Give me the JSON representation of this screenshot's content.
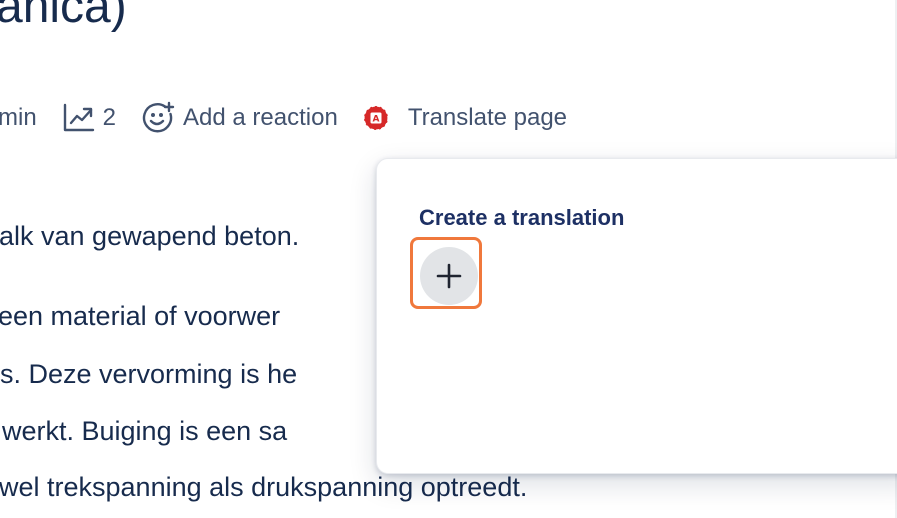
{
  "page": {
    "title": "anica)"
  },
  "meta": {
    "read_time": "min",
    "views_count": "2",
    "add_reaction_label": "Add a reaction",
    "translate_label": "Translate page"
  },
  "content": {
    "lines": [
      "alk van gewapend beton.",
      "een material of voorwer",
      "s. Deze vervorming is he",
      "werkt. Buiging is een sa",
      "wel trekspanning als drukspanning optreedt."
    ]
  },
  "popup": {
    "heading": "Create a translation",
    "add_button_label": "+"
  },
  "icons": {
    "views": "trending-chart-icon",
    "reaction": "add-reaction-icon",
    "translate": "translate-globe-icon",
    "add": "plus-icon"
  },
  "colors": {
    "highlight": "#f0783c",
    "translate_icon": "#d62828",
    "heading": "#1d3064"
  }
}
